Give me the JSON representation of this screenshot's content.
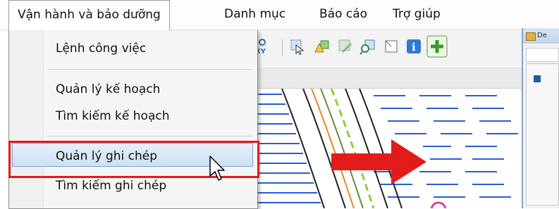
{
  "menubar": {
    "items": [
      "Vận hành và bảo dưỡng",
      "Danh mục",
      "Báo cáo",
      "Trợ giúp"
    ]
  },
  "dropdown": {
    "items": [
      "Lệnh công việc",
      "Quản lý kế hoạch",
      "Tìm kiếm kế hoạch",
      "Quản lý ghi chép",
      "Tìm kiếm ghi chép"
    ],
    "selected_index": 3
  },
  "toolbar": {
    "icons": [
      "xy-coordinate-icon",
      "select-tool-icon",
      "shape-tool-icon",
      "edit-tool-icon",
      "zoom-tool-icon",
      "window-tool-icon",
      "info-icon",
      "add-icon"
    ]
  },
  "side_window": {
    "title": "De"
  },
  "annotation": {
    "arrow_color": "#e31b1b",
    "highlight_color": "#e31b1b"
  }
}
